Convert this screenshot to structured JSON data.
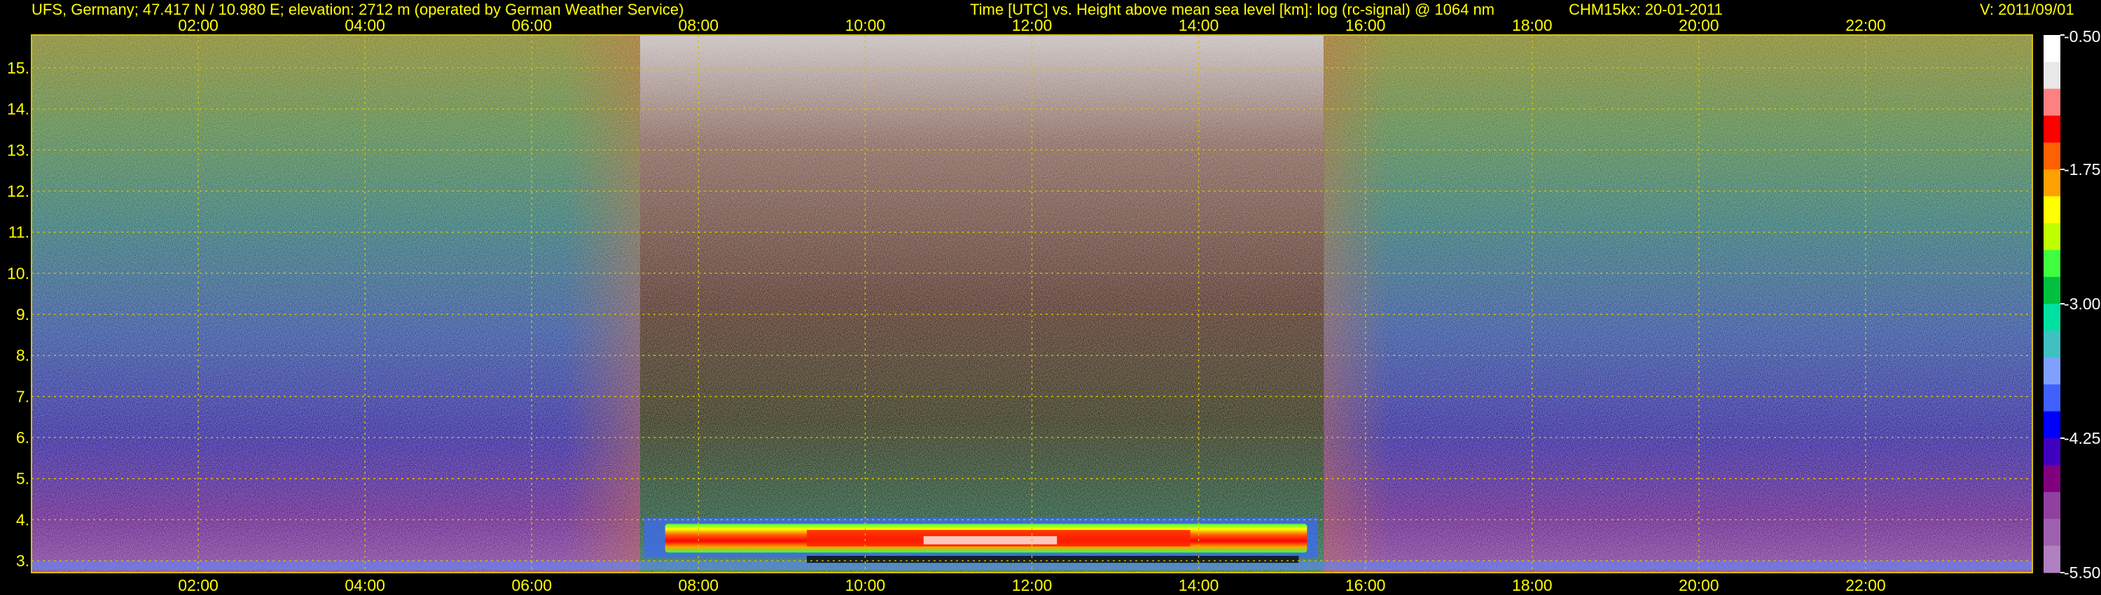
{
  "header": {
    "site": "UFS, Germany; 47.417 N / 10.980 E; elevation: 2712 m  (operated by German Weather Service)",
    "title": "Time [UTC] vs. Height above mean sea level [km]: log (rc-signal) @ 1064 nm",
    "instrument": "CHM15kx: 20-01-2011",
    "version": "V: 2011/09/01"
  },
  "colors": {
    "text": "#ffff00",
    "grid": "#d8c000",
    "background": "#000000"
  },
  "chart_data": {
    "type": "heatmap",
    "title": "Time [UTC] vs. Height above mean sea level [km]: log (rc-signal) @ 1064 nm",
    "xlabel": "Time [UTC]",
    "ylabel": "Height above mean sea level [km]",
    "xlim": [
      0,
      24
    ],
    "ylim": [
      2.712,
      15.8
    ],
    "x_ticks": [
      2,
      4,
      6,
      8,
      10,
      12,
      14,
      16,
      18,
      20,
      22
    ],
    "x_tick_labels": [
      "02:00",
      "04:00",
      "06:00",
      "08:00",
      "10:00",
      "12:00",
      "14:00",
      "16:00",
      "18:00",
      "20:00",
      "22:00"
    ],
    "y_ticks": [
      3,
      4,
      5,
      6,
      7,
      8,
      9,
      10,
      11,
      12,
      13,
      14,
      15
    ],
    "y_tick_labels": [
      "3.",
      "4.",
      "5.",
      "6.",
      "7.",
      "8.",
      "9.",
      "10.",
      "11.",
      "12.",
      "13.",
      "14.",
      "15."
    ],
    "grid": true,
    "colorbar": {
      "range": [
        -5.5,
        -0.5
      ],
      "ticks": [
        -0.5,
        -1.75,
        -3.0,
        -4.25,
        -5.5
      ],
      "tick_labels": [
        "-0.50",
        "-1.75",
        "-3.00",
        "-4.25",
        "-5.50"
      ],
      "colors": [
        "#ffffff",
        "#e8e8e8",
        "#ff8080",
        "#ff0000",
        "#ff6000",
        "#ffa000",
        "#ffff00",
        "#c0ff00",
        "#40ff40",
        "#00c040",
        "#00e0a0",
        "#40c0c0",
        "#80a0ff",
        "#4060ff",
        "#0000ff",
        "#4000c0",
        "#800080",
        "#9040a0",
        "#a060b0",
        "#b080c0"
      ]
    },
    "regions": [
      {
        "name": "night background (early)",
        "time_range": [
          0,
          7.3
        ],
        "height_range": [
          2.712,
          15.8
        ]
      },
      {
        "name": "daytime high background",
        "time_range": [
          7.3,
          15.5
        ],
        "height_range": [
          2.712,
          15.8
        ]
      },
      {
        "name": "night background (late)",
        "time_range": [
          15.5,
          24
        ],
        "height_range": [
          2.712,
          15.8
        ]
      },
      {
        "name": "strong backscatter layer",
        "time_range": [
          7.6,
          15.3
        ],
        "height_range": [
          3.2,
          3.9
        ],
        "value_max": -0.5
      }
    ]
  }
}
